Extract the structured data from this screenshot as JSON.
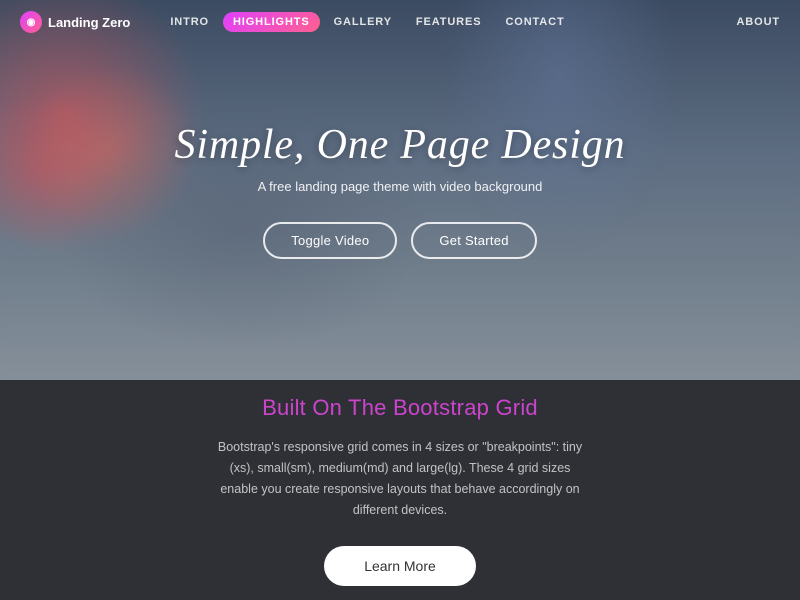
{
  "nav": {
    "logo_label": "Landing Zero",
    "links": [
      {
        "id": "intro",
        "label": "INTRO",
        "active": false
      },
      {
        "id": "highlights",
        "label": "HIGHLIGHTS",
        "active": true
      },
      {
        "id": "gallery",
        "label": "GALLERY",
        "active": false
      },
      {
        "id": "features",
        "label": "FEATURES",
        "active": false
      },
      {
        "id": "contact",
        "label": "CONTACT",
        "active": false
      }
    ],
    "about_label": "ABOUT"
  },
  "hero": {
    "title": "Simple, One Page Design",
    "subtitle": "A free landing page theme with video background",
    "toggle_video_label": "Toggle Video",
    "get_started_label": "Get Started"
  },
  "section": {
    "title": "Built On The Bootstrap Grid",
    "body": "Bootstrap's responsive grid comes in 4 sizes or \"breakpoints\": tiny (xs), small(sm), medium(md) and large(lg). These 4 grid sizes enable you create responsive layouts that behave accordingly on different devices.",
    "learn_more_label": "Learn More"
  }
}
